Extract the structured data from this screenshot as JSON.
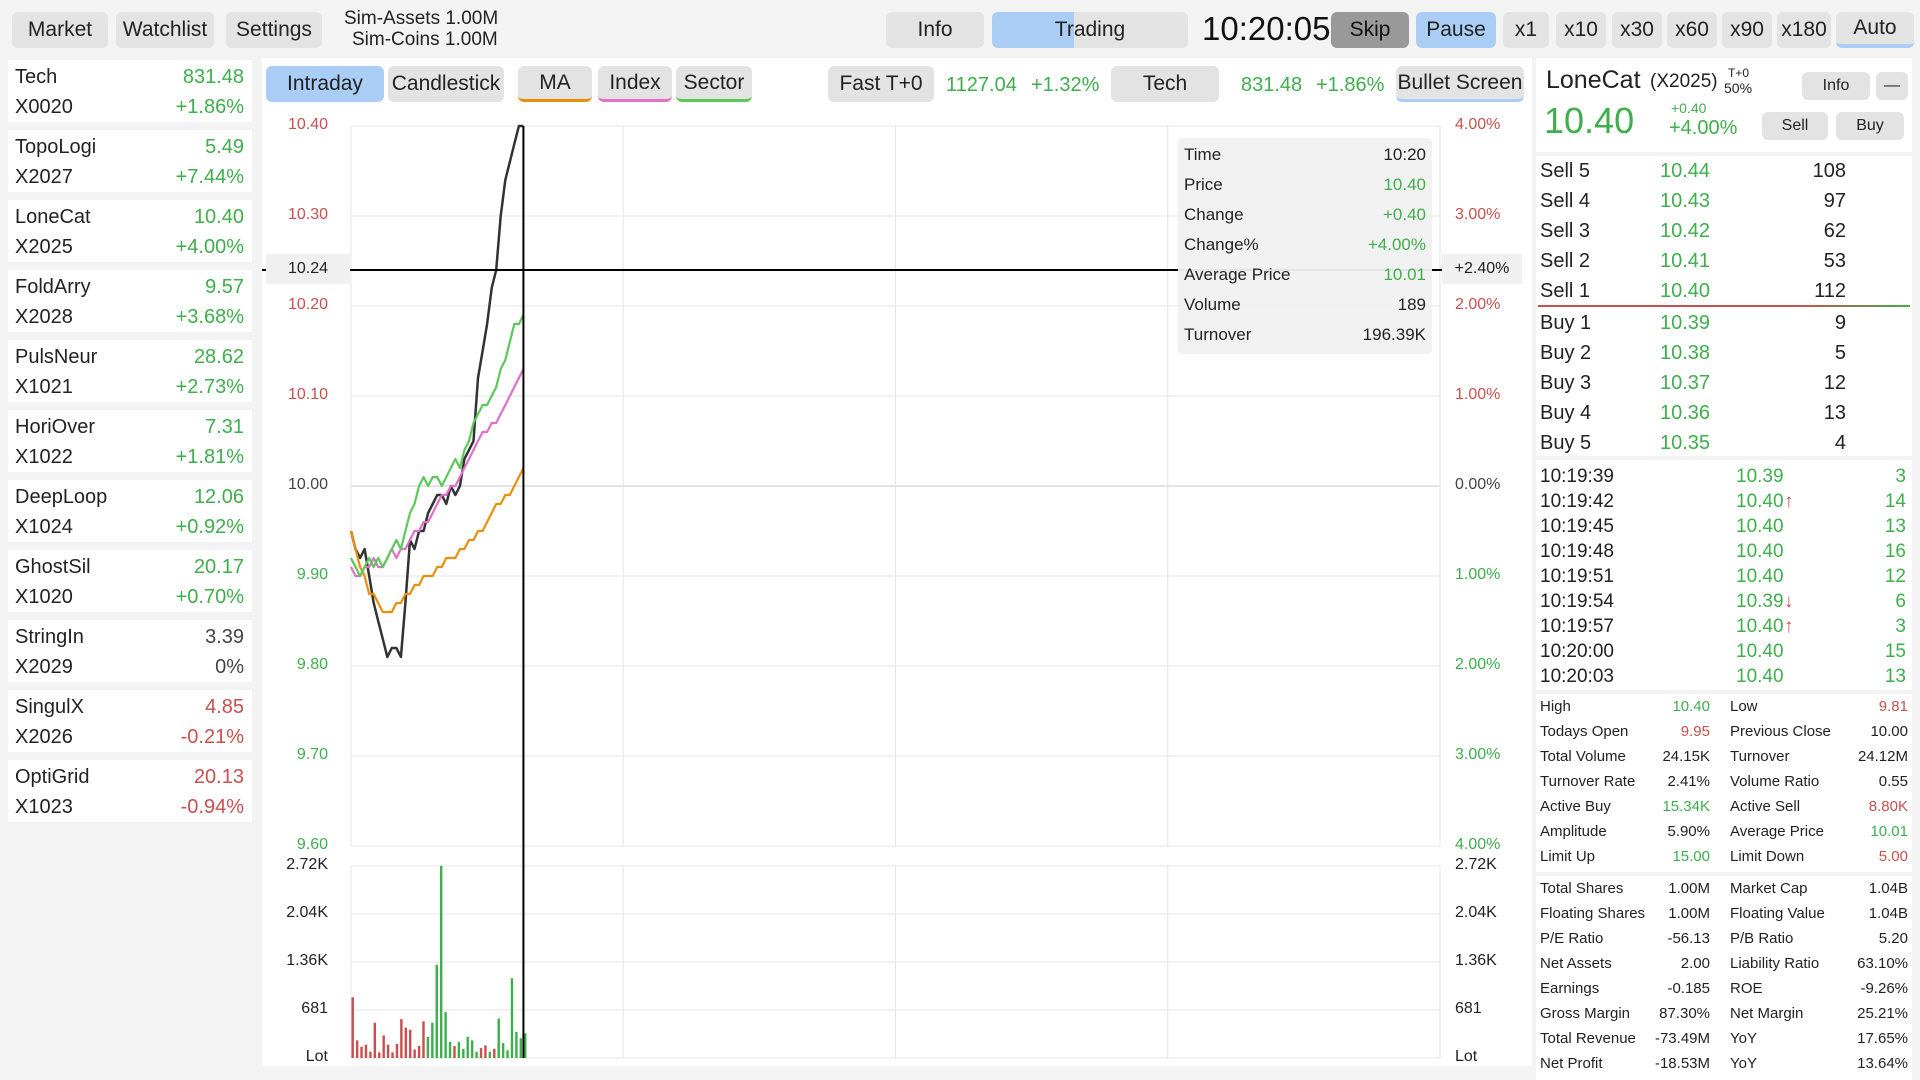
{
  "topbar": {
    "market": "Market",
    "watchlist": "Watchlist",
    "settings": "Settings",
    "sim_assets": "Sim-Assets 1.00M",
    "sim_coins": "Sim-Coins 1.00M",
    "info": "Info",
    "trading": "Trading",
    "clock": "10:20:05",
    "skip": "Skip",
    "pause": "Pause",
    "speeds": [
      "x1",
      "x10",
      "x30",
      "x60",
      "x90",
      "x180"
    ],
    "auto": "Auto"
  },
  "watchlist": [
    {
      "name": "Tech",
      "code": "X0020",
      "price": "831.48",
      "change": "+1.86%",
      "color": "#3fae4c",
      "price_color": "#3fae4c"
    },
    {
      "name": "TopoLogi",
      "code": "X2027",
      "price": "5.49",
      "change": "+7.44%",
      "color": "#3fae4c",
      "price_color": "#3fae4c"
    },
    {
      "name": "LoneCat",
      "code": "X2025",
      "price": "10.40",
      "change": "+4.00%",
      "color": "#3fae4c",
      "price_color": "#3fae4c"
    },
    {
      "name": "FoldArry",
      "code": "X2028",
      "price": "9.57",
      "change": "+3.68%",
      "color": "#3fae4c",
      "price_color": "#3fae4c"
    },
    {
      "name": "PulsNeur",
      "code": "X1021",
      "price": "28.62",
      "change": "+2.73%",
      "color": "#3fae4c",
      "price_color": "#3fae4c"
    },
    {
      "name": "HoriOver",
      "code": "X1022",
      "price": "7.31",
      "change": "+1.81%",
      "color": "#3fae4c",
      "price_color": "#3fae4c"
    },
    {
      "name": "DeepLoop",
      "code": "X1024",
      "price": "12.06",
      "change": "+0.92%",
      "color": "#3fae4c",
      "price_color": "#3fae4c"
    },
    {
      "name": "GhostSil",
      "code": "X1020",
      "price": "20.17",
      "change": "+0.70%",
      "color": "#3fae4c",
      "price_color": "#3fae4c"
    },
    {
      "name": "StringIn",
      "code": "X2029",
      "price": "3.39",
      "change": "0%",
      "color": "#444444",
      "price_color": "#444444"
    },
    {
      "name": "SingulX",
      "code": "X2026",
      "price": "4.85",
      "change": "-0.21%",
      "color": "#c8504e",
      "price_color": "#c8504e"
    },
    {
      "name": "OptiGrid",
      "code": "X1023",
      "price": "20.13",
      "change": "-0.94%",
      "color": "#c8504e",
      "price_color": "#c8504e"
    }
  ],
  "chart_toolbar": {
    "intraday": "Intraday",
    "candlestick": "Candlestick",
    "ma": "MA",
    "index": "Index",
    "sector": "Sector",
    "fast": "Fast T+0",
    "index_value": "1127.04",
    "index_change": "+1.32%",
    "sector_name": "Tech",
    "sector_value": "831.48",
    "sector_change": "+1.86%",
    "bullet_screen": "Bullet Screen"
  },
  "crosshair": {
    "price": "10.24",
    "pct": "+2.40%"
  },
  "tooltip": [
    {
      "label": "Time",
      "value": "10:20",
      "color": "#222222"
    },
    {
      "label": "Price",
      "value": "10.40",
      "color": "#3fae4c"
    },
    {
      "label": "Change",
      "value": "+0.40",
      "color": "#3fae4c"
    },
    {
      "label": "Change%",
      "value": "+4.00%",
      "color": "#3fae4c"
    },
    {
      "label": "Average Price",
      "value": "10.01",
      "color": "#3fae4c"
    },
    {
      "label": "Volume",
      "value": "189",
      "color": "#222222"
    },
    {
      "label": "Turnover",
      "value": "196.39K",
      "color": "#222222"
    }
  ],
  "stock": {
    "name": "LoneCat",
    "code": "(X2025)",
    "tplus": "T+0",
    "margin": "50%",
    "info_btn": "Info",
    "min_btn": "—",
    "price": "10.40",
    "change": "+0.40",
    "change_pct": "+4.00%",
    "sell_btn": "Sell",
    "buy_btn": "Buy"
  },
  "orderbook": [
    {
      "label": "Sell 5",
      "price": "10.44",
      "qty": "108"
    },
    {
      "label": "Sell 4",
      "price": "10.43",
      "qty": "97"
    },
    {
      "label": "Sell 3",
      "price": "10.42",
      "qty": "62"
    },
    {
      "label": "Sell 2",
      "price": "10.41",
      "qty": "53"
    },
    {
      "label": "Sell 1",
      "price": "10.40",
      "qty": "112"
    },
    {
      "label": "Buy 1",
      "price": "10.39",
      "qty": "9"
    },
    {
      "label": "Buy 2",
      "price": "10.38",
      "qty": "5"
    },
    {
      "label": "Buy 3",
      "price": "10.37",
      "qty": "12"
    },
    {
      "label": "Buy 4",
      "price": "10.36",
      "qty": "13"
    },
    {
      "label": "Buy 5",
      "price": "10.35",
      "qty": "4"
    }
  ],
  "ticks": [
    {
      "time": "10:19:39",
      "price": "10.39",
      "arrow": "",
      "qty": "3",
      "arrow_color": "#3fae4c"
    },
    {
      "time": "10:19:42",
      "price": "10.40",
      "arrow": "↑",
      "qty": "14",
      "arrow_color": "#c8504e"
    },
    {
      "time": "10:19:45",
      "price": "10.40",
      "arrow": "",
      "qty": "13",
      "arrow_color": "#3fae4c"
    },
    {
      "time": "10:19:48",
      "price": "10.40",
      "arrow": "",
      "qty": "16",
      "arrow_color": "#3fae4c"
    },
    {
      "time": "10:19:51",
      "price": "10.40",
      "arrow": "",
      "qty": "12",
      "arrow_color": "#3fae4c"
    },
    {
      "time": "10:19:54",
      "price": "10.39",
      "arrow": "↓",
      "qty": "6",
      "arrow_color": "#c8504e"
    },
    {
      "time": "10:19:57",
      "price": "10.40",
      "arrow": "↑",
      "qty": "3",
      "arrow_color": "#c8504e"
    },
    {
      "time": "10:20:00",
      "price": "10.40",
      "arrow": "",
      "qty": "15",
      "arrow_color": "#3fae4c"
    },
    {
      "time": "10:20:03",
      "price": "10.40",
      "arrow": "",
      "qty": "13",
      "arrow_color": "#3fae4c"
    }
  ],
  "stats1": [
    {
      "l1": "High",
      "v1": "10.40",
      "c1": "#3fae4c",
      "l2": "Low",
      "v2": "9.81",
      "c2": "#c8504e"
    },
    {
      "l1": "Todays Open",
      "v1": "9.95",
      "c1": "#c8504e",
      "l2": "Previous Close",
      "v2": "10.00",
      "c2": "#222222"
    },
    {
      "l1": "Total Volume",
      "v1": "24.15K",
      "c1": "#222222",
      "l2": "Turnover",
      "v2": "24.12M",
      "c2": "#222222"
    },
    {
      "l1": "Turnover Rate",
      "v1": "2.41%",
      "c1": "#222222",
      "l2": "Volume Ratio",
      "v2": "0.55",
      "c2": "#222222"
    },
    {
      "l1": "Active Buy",
      "v1": "15.34K",
      "c1": "#3fae4c",
      "l2": "Active Sell",
      "v2": "8.80K",
      "c2": "#c8504e"
    },
    {
      "l1": "Amplitude",
      "v1": "5.90%",
      "c1": "#222222",
      "l2": "Average Price",
      "v2": "10.01",
      "c2": "#3fae4c"
    },
    {
      "l1": "Limit Up",
      "v1": "15.00",
      "c1": "#3fae4c",
      "l2": "Limit Down",
      "v2": "5.00",
      "c2": "#c8504e"
    }
  ],
  "stats2": [
    {
      "l1": "Total Shares",
      "v1": "1.00M",
      "l2": "Market Cap",
      "v2": "1.04B"
    },
    {
      "l1": "Floating Shares",
      "v1": "1.00M",
      "l2": "Floating Value",
      "v2": "1.04B"
    },
    {
      "l1": "P/E Ratio",
      "v1": "-56.13",
      "l2": "P/B Ratio",
      "v2": "5.20"
    },
    {
      "l1": "Net Assets",
      "v1": "2.00",
      "l2": "Liability Ratio",
      "v2": "63.10%"
    },
    {
      "l1": "Earnings",
      "v1": "-0.185",
      "l2": "ROE",
      "v2": "-9.26%"
    },
    {
      "l1": "Gross Margin",
      "v1": "87.30%",
      "l2": "Net Margin",
      "v2": "25.21%"
    },
    {
      "l1": "Total Revenue",
      "v1": "-73.49M",
      "l2": "YoY",
      "v2": "17.65%"
    },
    {
      "l1": "Net Profit",
      "v1": "-18.53M",
      "l2": "YoY",
      "v2": "13.64%"
    }
  ],
  "colors": {
    "up": "#3fae4c",
    "down": "#c8504e",
    "accent": "#aacdf5",
    "price_line": "#333333",
    "avg_line": "#e8900c",
    "index_line": "#e070c8",
    "sector_line": "#5cc85a"
  },
  "chart_data": {
    "type": "line",
    "price_axis": {
      "ylim": [
        9.6,
        10.4
      ],
      "ticks": [
        "10.40",
        "10.30",
        "10.20",
        "10.10",
        "10.00",
        "9.90",
        "9.80",
        "9.70",
        "9.60"
      ],
      "tick_colors": [
        "#c8504e",
        "#c8504e",
        "#c8504e",
        "#c8504e",
        "#444444",
        "#3fae4c",
        "#3fae4c",
        "#3fae4c",
        "#3fae4c"
      ]
    },
    "pct_axis": {
      "ticks": [
        "4.00%",
        "3.00%",
        "2.00%",
        "1.00%",
        "0.00%",
        "1.00%",
        "2.00%",
        "3.00%",
        "4.00%"
      ],
      "tick_colors": [
        "#c8504e",
        "#c8504e",
        "#c8504e",
        "#c8504e",
        "#444444",
        "#3fae4c",
        "#3fae4c",
        "#3fae4c",
        "#3fae4c"
      ]
    },
    "volume_axis": {
      "ylim": [
        0,
        2720
      ],
      "ticks": [
        "2.72K",
        "2.04K",
        "1.36K",
        "681",
        "Lot"
      ]
    },
    "x_minutes_total": 240,
    "series": [
      {
        "key": "price",
        "color": "#333333",
        "values": [
          9.95,
          9.93,
          9.92,
          9.93,
          9.9,
          9.87,
          9.85,
          9.83,
          9.81,
          9.82,
          9.82,
          9.81,
          9.87,
          9.94,
          9.93,
          9.95,
          9.95,
          9.97,
          9.98,
          9.99,
          9.99,
          9.98,
          10.0,
          9.99,
          10.0,
          10.03,
          10.04,
          10.05,
          10.12,
          10.15,
          10.18,
          10.22,
          10.24,
          10.3,
          10.34,
          10.36,
          10.38,
          10.4,
          10.4
        ]
      },
      {
        "key": "average",
        "color": "#e8900c",
        "values": [
          9.95,
          9.93,
          9.91,
          9.9,
          9.88,
          9.88,
          9.87,
          9.86,
          9.86,
          9.86,
          9.87,
          9.87,
          9.88,
          9.88,
          9.89,
          9.89,
          9.9,
          9.9,
          9.9,
          9.91,
          9.91,
          9.92,
          9.92,
          9.92,
          9.93,
          9.93,
          9.94,
          9.94,
          9.95,
          9.95,
          9.96,
          9.97,
          9.98,
          9.98,
          9.99,
          9.99,
          10.0,
          10.01,
          10.02
        ]
      },
      {
        "key": "index",
        "color": "#e070c8",
        "values": [
          9.91,
          9.9,
          9.9,
          9.91,
          9.91,
          9.92,
          9.91,
          9.91,
          9.92,
          9.93,
          9.92,
          9.93,
          9.93,
          9.94,
          9.95,
          9.95,
          9.96,
          9.96,
          9.97,
          9.98,
          9.99,
          9.99,
          10.0,
          10.0,
          10.01,
          10.02,
          10.03,
          10.04,
          10.05,
          10.06,
          10.06,
          10.07,
          10.07,
          10.08,
          10.09,
          10.1,
          10.11,
          10.12,
          10.13
        ]
      },
      {
        "key": "sector",
        "color": "#5cc85a",
        "values": [
          9.92,
          9.91,
          9.9,
          9.91,
          9.92,
          9.91,
          9.92,
          9.91,
          9.92,
          9.93,
          9.94,
          9.93,
          9.95,
          9.97,
          9.98,
          10.0,
          10.01,
          10.0,
          10.01,
          10.01,
          10.0,
          10.01,
          10.02,
          10.03,
          10.02,
          10.04,
          10.05,
          10.07,
          10.08,
          10.09,
          10.09,
          10.1,
          10.11,
          10.13,
          10.14,
          10.16,
          10.18,
          10.18,
          10.19
        ]
      }
    ],
    "volume": [
      {
        "v": 860,
        "up": false
      },
      {
        "v": 250,
        "up": false
      },
      {
        "v": 160,
        "up": false
      },
      {
        "v": 190,
        "up": false
      },
      {
        "v": 90,
        "up": false
      },
      {
        "v": 500,
        "up": false
      },
      {
        "v": 80,
        "up": false
      },
      {
        "v": 320,
        "up": false
      },
      {
        "v": 190,
        "up": false
      },
      {
        "v": 80,
        "up": false
      },
      {
        "v": 200,
        "up": false
      },
      {
        "v": 550,
        "up": false
      },
      {
        "v": 430,
        "up": false
      },
      {
        "v": 400,
        "up": false
      },
      {
        "v": 120,
        "up": false
      },
      {
        "v": 170,
        "up": false
      },
      {
        "v": 520,
        "up": false
      },
      {
        "v": 300,
        "up": true
      },
      {
        "v": 500,
        "up": true
      },
      {
        "v": 1320,
        "up": true
      },
      {
        "v": 2720,
        "up": true
      },
      {
        "v": 650,
        "up": true
      },
      {
        "v": 230,
        "up": true
      },
      {
        "v": 170,
        "up": false
      },
      {
        "v": 230,
        "up": true
      },
      {
        "v": 130,
        "up": true
      },
      {
        "v": 300,
        "up": true
      },
      {
        "v": 250,
        "up": true
      },
      {
        "v": 90,
        "up": true
      },
      {
        "v": 140,
        "up": false
      },
      {
        "v": 180,
        "up": false
      },
      {
        "v": 90,
        "up": true
      },
      {
        "v": 130,
        "up": false
      },
      {
        "v": 560,
        "up": true
      },
      {
        "v": 210,
        "up": true
      },
      {
        "v": 110,
        "up": true
      },
      {
        "v": 1130,
        "up": true
      },
      {
        "v": 370,
        "up": true
      },
      {
        "v": 280,
        "up": true
      },
      {
        "v": 350,
        "up": true
      }
    ]
  }
}
